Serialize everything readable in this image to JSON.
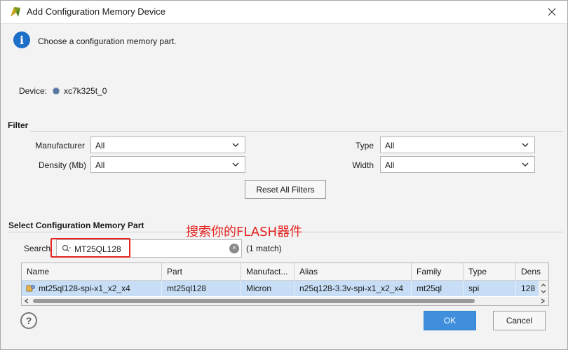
{
  "window": {
    "title": "Add Configuration Memory Device"
  },
  "info": {
    "text": "Choose a configuration memory part."
  },
  "device": {
    "label": "Device:",
    "value": "xc7k325t_0"
  },
  "filter": {
    "title": "Filter",
    "manufacturer_label": "Manufacturer",
    "manufacturer_value": "All",
    "density_label": "Density (Mb)",
    "density_value": "All",
    "type_label": "Type",
    "type_value": "All",
    "width_label": "Width",
    "width_value": "All",
    "reset_label": "Reset All Filters"
  },
  "select_section": {
    "title": "Select Configuration Memory Part"
  },
  "annotation": {
    "text": "搜索你的FLASH器件",
    "color": "#e52420"
  },
  "search": {
    "label": "Search",
    "value": "MT25QL128",
    "match_text": "(1 match)"
  },
  "table": {
    "columns": [
      "Name",
      "Part",
      "Manufact...",
      "Alias",
      "Family",
      "Type",
      "Dens"
    ],
    "rows": [
      {
        "name": "mt25ql128-spi-x1_x2_x4",
        "part": "mt25ql128",
        "manufacturer": "Micron",
        "alias": "n25q128-3.3v-spi-x1_x2_x4",
        "family": "mt25ql",
        "type": "spi",
        "density": "128"
      }
    ]
  },
  "buttons": {
    "help": "?",
    "ok": "OK",
    "cancel": "Cancel"
  },
  "colors": {
    "accent": "#3f8fdc",
    "selection": "#c7def6",
    "info": "#1e6fc8"
  }
}
